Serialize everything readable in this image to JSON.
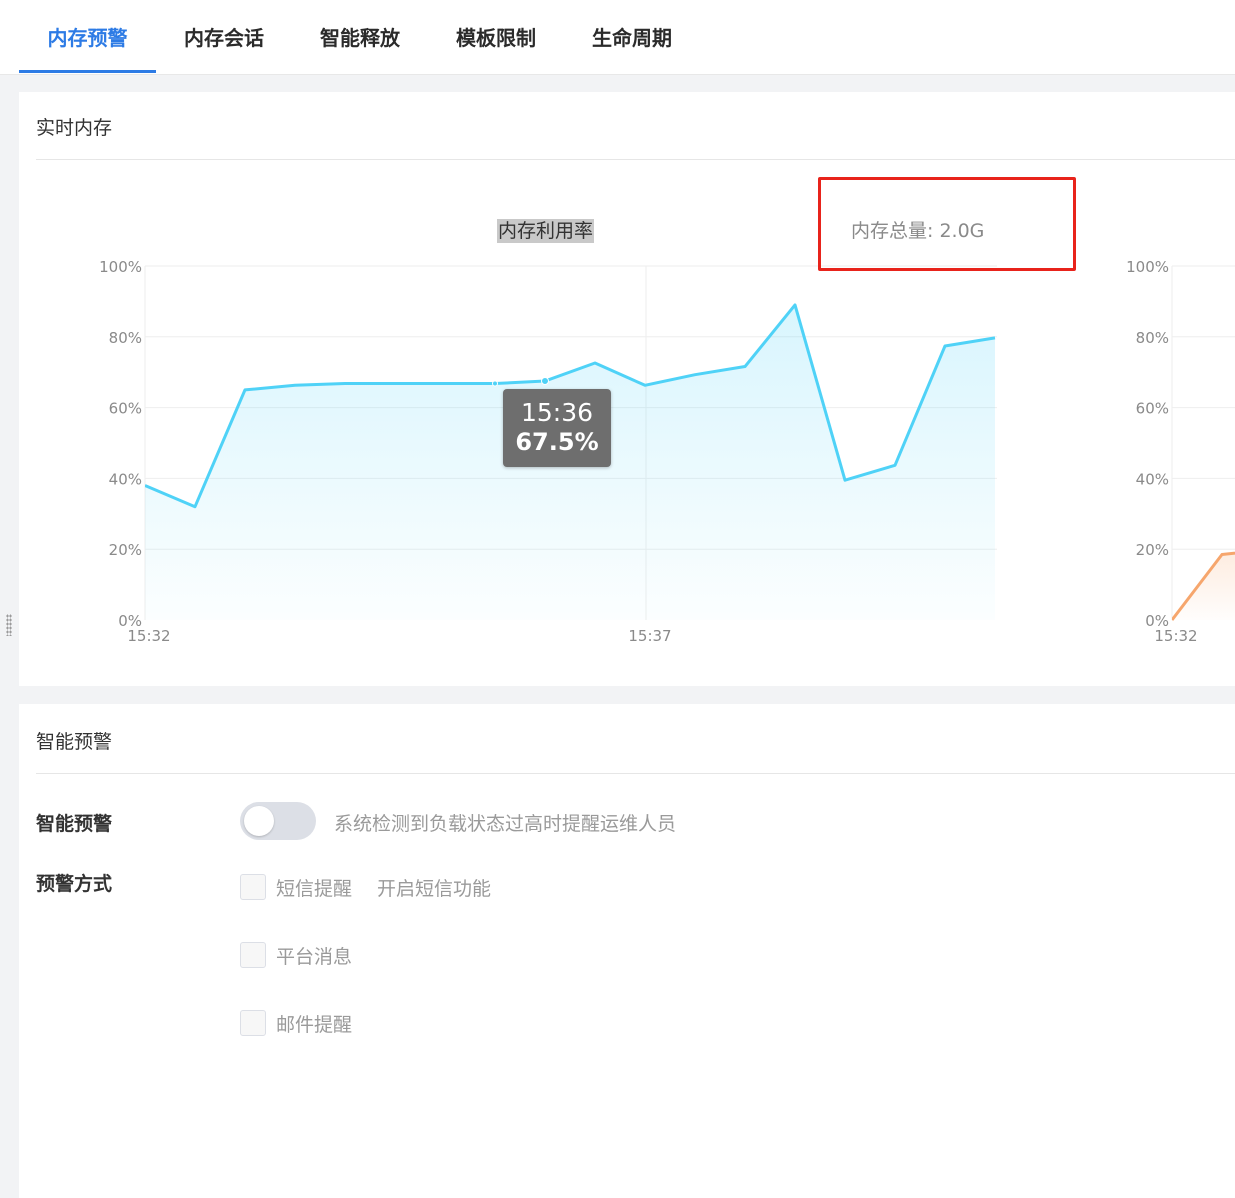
{
  "tabs": [
    {
      "label": "内存预警",
      "active": true
    },
    {
      "label": "内存会话",
      "active": false
    },
    {
      "label": "智能释放",
      "active": false
    },
    {
      "label": "模板限制",
      "active": false
    },
    {
      "label": "生命周期",
      "active": false
    }
  ],
  "realtime": {
    "section_title": "实时内存",
    "chart_title": "内存利用率",
    "total_memory": "内存总量: 2.0G",
    "tooltip": {
      "time": "15:36",
      "value": "67.5%"
    }
  },
  "alert": {
    "section_title": "智能预警",
    "switch_label": "智能预警",
    "switch_on": false,
    "switch_desc": "系统检测到负载状态过高时提醒运维人员",
    "method_label": "预警方式",
    "options": [
      {
        "label": "短信提醒",
        "link": "开启短信功能",
        "checked": false
      },
      {
        "label": "平台消息",
        "checked": false
      },
      {
        "label": "邮件提醒",
        "checked": false
      }
    ]
  },
  "colors": {
    "accent": "#2d7be5",
    "line_main": "#4fd2f7",
    "line_secondary": "#f6a66d",
    "highlight_box": "#e8231b"
  },
  "chart_data": [
    {
      "type": "area",
      "title": "内存利用率",
      "y_tick_labels": [
        "0%",
        "20%",
        "40%",
        "60%",
        "80%",
        "100%"
      ],
      "x_tick_labels": [
        "15:32",
        "15:37"
      ],
      "ylim": [
        0,
        100
      ],
      "grid": true,
      "series": [
        {
          "values": [
            38,
            32,
            65,
            66.3,
            66.8,
            66.8,
            66.8,
            66.8,
            67.5,
            72.6,
            66.3,
            69.3,
            71.6,
            89,
            39.5,
            43.7,
            77.4,
            79.7
          ]
        }
      ]
    },
    {
      "type": "area",
      "y_tick_labels": [
        "0%",
        "20%",
        "40%",
        "60%",
        "80%",
        "100%"
      ],
      "x_tick_labels": [
        "15:32"
      ],
      "ylim": [
        0,
        100
      ],
      "grid": true,
      "series": [
        {
          "values": [
            0,
            18.5,
            20
          ]
        }
      ]
    }
  ]
}
